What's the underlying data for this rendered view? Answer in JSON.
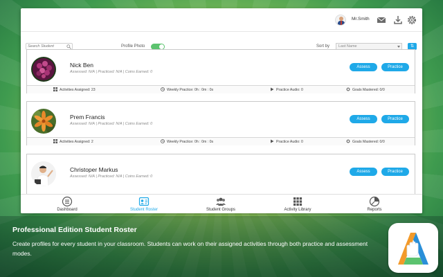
{
  "header": {
    "user_name": "Mr.Smith"
  },
  "filters": {
    "search_placeholder": "Search Student",
    "profile_photo_label": "Profile Photo",
    "profile_photo_on": true,
    "sort_by_label": "Sort by",
    "sort_value": "Last Name",
    "sort_button_label": "⇅"
  },
  "students": [
    {
      "name": "Nick Ben",
      "meta": "Assessed: N/A   |   Practiced: N/A   |   Coins Earned: 0",
      "assess_label": "Assess",
      "practice_label": "Practice",
      "activities": "Activities Assigned: 23",
      "weekly": "Weekly Practice: 0h : 0m : 0s",
      "audio": "Practice Audio: 0",
      "goals": "Goals Mastered: 0/0"
    },
    {
      "name": "Prem Francis",
      "meta": "Assessed: N/A   |   Practiced: N/A   |   Coins Earned: 0",
      "assess_label": "Assess",
      "practice_label": "Practice",
      "activities": "Activities Assigned: 2",
      "weekly": "Weekly Practice: 0h : 0m : 0s",
      "audio": "Practice Audio: 0",
      "goals": "Goals Mastered: 0/0"
    },
    {
      "name": "Christoper Markus",
      "meta": "Assessed: N/A   |   Practiced: N/A   |   Coins Earned: 0",
      "assess_label": "Assess",
      "practice_label": "Practice"
    }
  ],
  "nav": {
    "dashboard": "Dashboard",
    "student_roster": "Student Roster",
    "student_groups": "Student Groups",
    "activity_library": "Activity Library",
    "reports": "Reports",
    "active": "student_roster"
  },
  "caption": {
    "title": "Professional Edition Student Roster",
    "text": "Create profiles for every student in your classroom. Students can work on their assigned activities through both practice and assessment modes."
  },
  "colors": {
    "accent": "#1fa9e8",
    "toggle_on": "#5cc36f"
  }
}
